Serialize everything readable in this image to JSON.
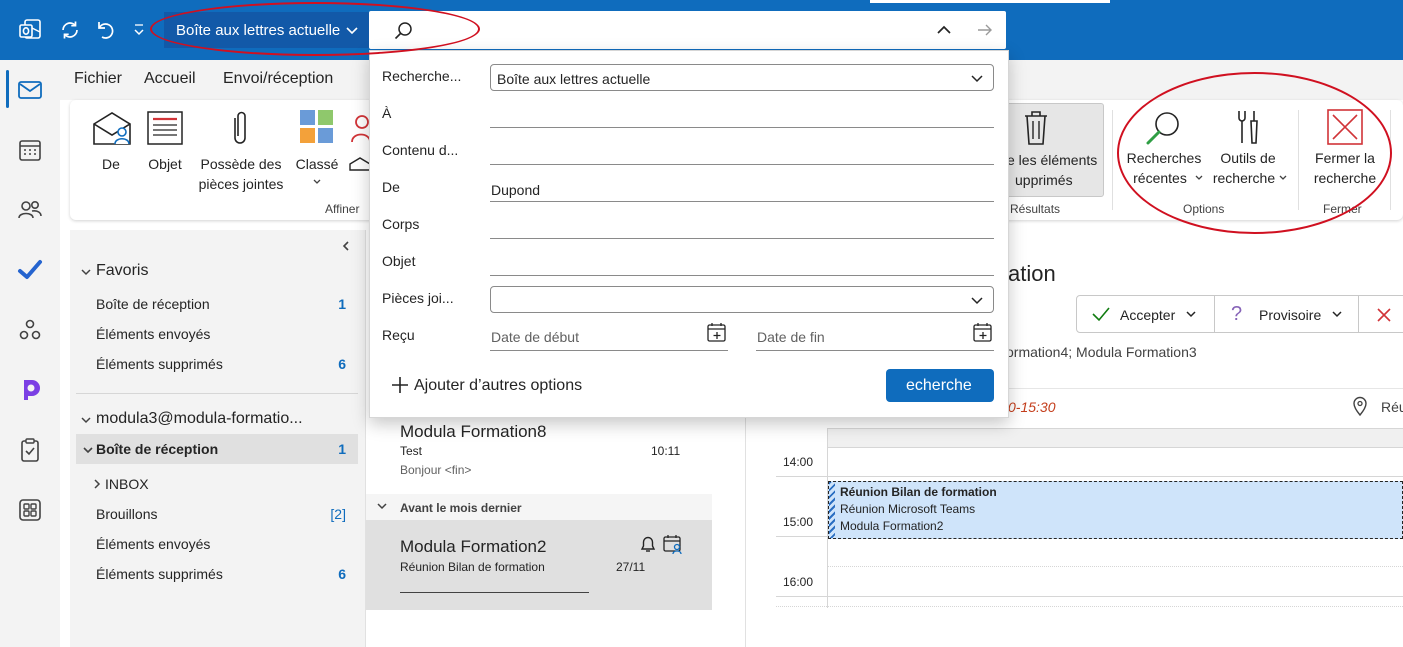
{
  "titlebar": {
    "mailbox_scope": "Boîte aux lettres actuelle"
  },
  "menu": [
    "Fichier",
    "Accueil",
    "Envoi/réception"
  ],
  "ribbon": {
    "de": "De",
    "objet": "Objet",
    "attachments_l1": "Possède des",
    "attachments_l2": "pièces jointes",
    "classe": "Classé",
    "affiner": "Affiner",
    "deleted_l1": "e les éléments",
    "deleted_l2": "upprimés",
    "resultats": "Résultats",
    "recent_l1": "Recherches",
    "recent_l2": "récentes",
    "tools_l1": "Outils de",
    "tools_l2": "recherche",
    "options": "Options",
    "close_l1": "Fermer la",
    "close_l2": "recherche",
    "fermer": "Fermer"
  },
  "folders": {
    "favoris": "Favoris",
    "fav_items": [
      {
        "label": "Boîte de réception",
        "count": "1"
      },
      {
        "label": "Éléments envoyés",
        "count": ""
      },
      {
        "label": "Éléments supprimés",
        "count": "6"
      }
    ],
    "account": "modula3@modula-formatio...",
    "inbox": "Boîte de réception",
    "inbox_count": "1",
    "sub": [
      {
        "label": "INBOX",
        "count": ""
      },
      {
        "label": "Brouillons",
        "count": "[2]"
      },
      {
        "label": "Éléments envoyés",
        "count": ""
      },
      {
        "label": "Éléments supprimés",
        "count": "6"
      }
    ]
  },
  "messages": {
    "m1_sender": "Modula Formation8",
    "m1_subject": "Test",
    "m1_time": "10:11",
    "m1_preview": "Bonjour <fin>",
    "group": "Avant le mois dernier",
    "m2_sender": "Modula Formation2",
    "m2_subject": "Réunion Bilan de formation",
    "m2_date": "27/11"
  },
  "reading": {
    "title_partial": "ation",
    "accept": "Accepter",
    "tentative": "Provisoire",
    "recipients": "ormation4; Modula Formation3",
    "time_partial": "0-15:30",
    "loc_partial": "Réu",
    "hours": [
      "14:00",
      "15:00",
      "16:00"
    ],
    "event_title": "Réunion Bilan de formation",
    "event_line2": "Réunion Microsoft Teams",
    "event_line3": "Modula Formation2"
  },
  "search": {
    "fields": {
      "scope_label": "Recherche...",
      "scope_value": "Boîte aux lettres actuelle",
      "to": "À",
      "content": "Contenu d...",
      "from": "De",
      "from_value": "Dupond",
      "body": "Corps",
      "subject": "Objet",
      "attachments": "Pièces joi...",
      "received": "Reçu",
      "start_placeholder": "Date de début",
      "end_placeholder": "Date de fin"
    },
    "more_options": "Ajouter d’autres options",
    "submit": "echerche"
  },
  "colors": {
    "brand": "#0f6cbd",
    "annotation": "#d01020",
    "event_fill": "#cfe4fa"
  }
}
